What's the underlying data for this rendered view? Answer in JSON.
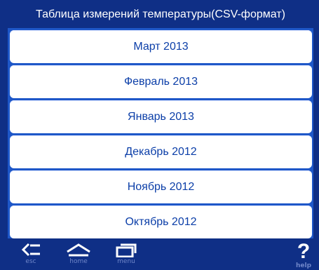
{
  "header": {
    "title": "Таблица измерений температуры(CSV-формат)"
  },
  "months": [
    {
      "label": "Март 2013"
    },
    {
      "label": "Февраль 2013"
    },
    {
      "label": "Январь 2013"
    },
    {
      "label": "Декабрь 2012"
    },
    {
      "label": "Ноябрь 2012"
    },
    {
      "label": "Октябрь 2012"
    }
  ],
  "toolbar": {
    "back_label": "esc",
    "home_label": "home",
    "menu_label": "menu",
    "help_label": "help",
    "help_glyph": "?"
  },
  "icons": {
    "back": "back-arrow-icon",
    "home": "home-icon",
    "menu": "menu-icon",
    "help": "help-icon"
  },
  "colors": {
    "frame": "#0f2f86",
    "list_background": "#1e57c8",
    "item_text": "#0b3ea8",
    "header_text": "#ffffff"
  }
}
